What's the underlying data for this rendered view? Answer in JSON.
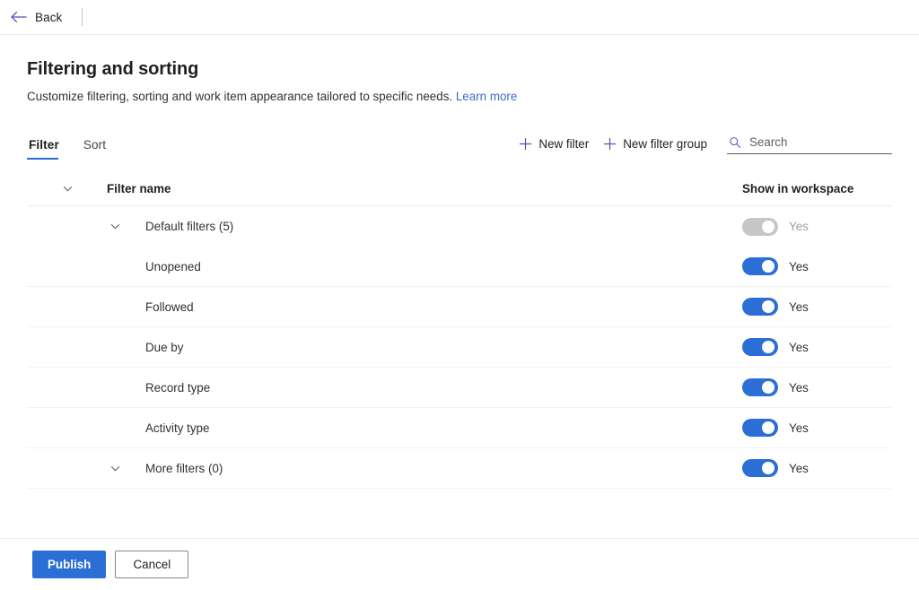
{
  "topbar": {
    "back_label": "Back",
    "back_icon": "arrow-left-icon",
    "accent": "#4f52b2"
  },
  "header": {
    "title": "Filtering and sorting",
    "subtitle": "Customize filtering, sorting and work item appearance tailored to specific needs.",
    "learn_more": "Learn more",
    "link_color": "#3b6dc6"
  },
  "tabs": [
    {
      "label": "Filter",
      "active": true
    },
    {
      "label": "Sort",
      "active": false
    }
  ],
  "commands": [
    {
      "label": "New filter",
      "icon": "plus-icon"
    },
    {
      "label": "New filter group",
      "icon": "plus-icon"
    }
  ],
  "search": {
    "placeholder": "Search",
    "value": "",
    "icon": "search-icon"
  },
  "table": {
    "columns": {
      "name": "Filter name",
      "toggle": "Show in workspace"
    },
    "header_chevron": "chevron-down-icon",
    "rows": [
      {
        "label": "Default filters (5)",
        "chevron": "chevron-down-icon",
        "has_chevron": true,
        "toggle_on": true,
        "toggle_disabled": true,
        "toggle_text": "Yes"
      },
      {
        "label": "Unopened",
        "chevron": "",
        "has_chevron": false,
        "toggle_on": true,
        "toggle_disabled": false,
        "toggle_text": "Yes"
      },
      {
        "label": "Followed",
        "chevron": "",
        "has_chevron": false,
        "toggle_on": true,
        "toggle_disabled": false,
        "toggle_text": "Yes"
      },
      {
        "label": "Due by",
        "chevron": "",
        "has_chevron": false,
        "toggle_on": true,
        "toggle_disabled": false,
        "toggle_text": "Yes"
      },
      {
        "label": "Record type",
        "chevron": "",
        "has_chevron": false,
        "toggle_on": true,
        "toggle_disabled": false,
        "toggle_text": "Yes"
      },
      {
        "label": "Activity type",
        "chevron": "",
        "has_chevron": false,
        "toggle_on": true,
        "toggle_disabled": false,
        "toggle_text": "Yes"
      },
      {
        "label": "More filters (0)",
        "chevron": "chevron-down-icon",
        "has_chevron": true,
        "toggle_on": true,
        "toggle_disabled": false,
        "toggle_text": "Yes"
      }
    ]
  },
  "footer": {
    "publish_label": "Publish",
    "cancel_label": "Cancel",
    "primary_color": "#2b6fd6"
  }
}
